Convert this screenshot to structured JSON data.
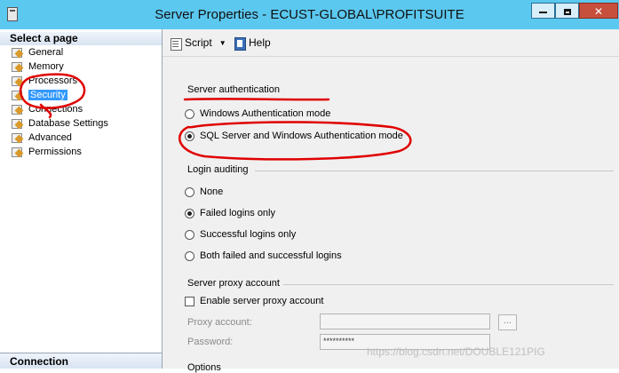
{
  "window": {
    "title": "Server Properties - ECUST-GLOBAL\\PROFITSUITE",
    "controls": [
      "minimize",
      "maximize",
      "close"
    ]
  },
  "left_panel": {
    "header": "Select a page",
    "pages": [
      {
        "label": "General",
        "selected": false
      },
      {
        "label": "Memory",
        "selected": false
      },
      {
        "label": "Processors",
        "selected": false
      },
      {
        "label": "Security",
        "selected": true
      },
      {
        "label": "Connections",
        "selected": false
      },
      {
        "label": "Database Settings",
        "selected": false
      },
      {
        "label": "Advanced",
        "selected": false
      },
      {
        "label": "Permissions",
        "selected": false
      }
    ],
    "footer_header": "Connection"
  },
  "toolbar": {
    "script_label": "Script",
    "help_label": "Help"
  },
  "server_auth": {
    "heading": "Server authentication",
    "options": [
      {
        "label": "Windows Authentication mode",
        "checked": false
      },
      {
        "label": "SQL Server and Windows Authentication mode",
        "checked": true
      }
    ]
  },
  "login_auditing": {
    "heading": "Login auditing",
    "options": [
      {
        "label": "None",
        "checked": false
      },
      {
        "label": "Failed logins only",
        "checked": true
      },
      {
        "label": "Successful logins only",
        "checked": false
      },
      {
        "label": "Both failed and successful logins",
        "checked": false
      }
    ]
  },
  "proxy": {
    "heading": "Server proxy account",
    "enable_label": "Enable server proxy account",
    "enabled": false,
    "proxy_account_label": "Proxy account:",
    "proxy_account_value": "",
    "browse_label": "...",
    "password_label": "Password:",
    "password_value": "**********"
  },
  "options_heading_partial": "Options",
  "watermark": "https://blog.csdn.net/DOUBLE121PIG",
  "colors": {
    "titlebar": "#5bc8f0",
    "selection": "#3399ff",
    "annotation": "#e00000"
  }
}
